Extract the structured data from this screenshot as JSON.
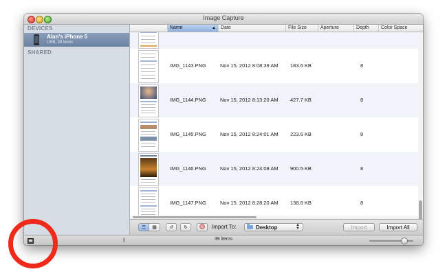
{
  "window": {
    "title": "Image Capture"
  },
  "sidebar": {
    "devices_heading": "DEVICES",
    "device": {
      "name": "Alan's iPhone 5",
      "subtitle": "USB, 39 items"
    },
    "shared_heading": "SHARED"
  },
  "columns": {
    "name": "Name",
    "date": "Date",
    "file_size": "File Size",
    "aperture": "Aperture",
    "depth": "Depth",
    "color_space": "Color Space"
  },
  "rows": [
    {
      "name": "IMG_1143.PNG",
      "date": "Nov 15, 2012 8:08:39 AM",
      "size": "183.6 KB",
      "depth": "8"
    },
    {
      "name": "IMG_1144.PNG",
      "date": "Nov 15, 2012 8:13:20 AM",
      "size": "427.7 KB",
      "depth": "8"
    },
    {
      "name": "IMG_1145.PNG",
      "date": "Nov 15, 2012 8:24:01 AM",
      "size": "223.6 KB",
      "depth": "8"
    },
    {
      "name": "IMG_1146.PNG",
      "date": "Nov 15, 2012 8:24:08 AM",
      "size": "900.5 KB",
      "depth": "8"
    },
    {
      "name": "IMG_1147.PNG",
      "date": "Nov 15, 2012 8:28:20 AM",
      "size": "138.6 KB",
      "depth": "8"
    }
  ],
  "toolbar": {
    "import_to_label": "Import To:",
    "destination": "Desktop",
    "import_label": "Import",
    "import_all_label": "Import All"
  },
  "status": {
    "item_count": "39 items"
  },
  "colors": {
    "annotation": "#f02a1a",
    "selection": "#6c82a3"
  }
}
